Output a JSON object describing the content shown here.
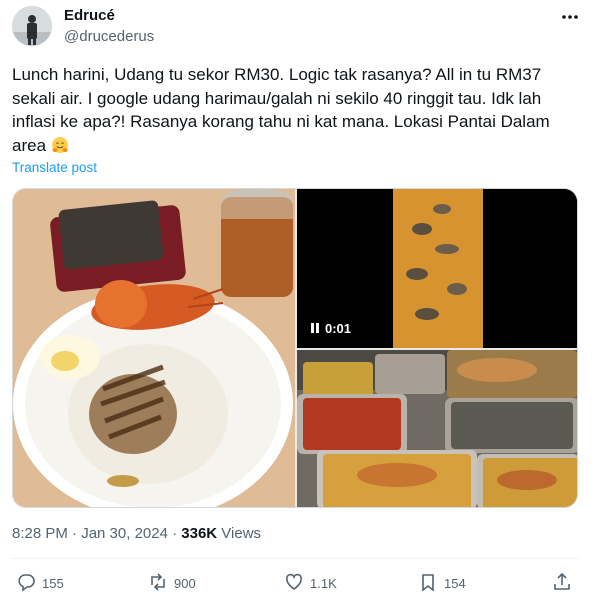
{
  "author": {
    "name": "Edrucé",
    "handle": "@drucederus"
  },
  "tweet": {
    "text": "Lunch harini, Udang tu sekor RM30. Logic tak rasanya? All in tu RM37 sekali air. I google udang harimau/galah ni sekilo 40 ringgit tau. Idk lah inflasi ke apa?! Rasanya korang tahu ni kat mana. Lokasi Pantai Dalam area",
    "emoji": "hugging-face",
    "translate_label": "Translate post",
    "time": "8:28 PM · Jan 30, 2024 · ",
    "views_count": "336K",
    "views_label": " Views"
  },
  "media": {
    "video_time": "0:01"
  },
  "actions": {
    "replies": "155",
    "reposts": "900",
    "likes": "1.1K",
    "bookmarks": "154"
  },
  "colors": {
    "accent": "#1d9bf0",
    "secondary_text": "#536471",
    "primary_text": "#0f1419"
  },
  "icons": [
    "more-icon",
    "reply-icon",
    "repost-icon",
    "like-icon",
    "bookmark-icon",
    "share-icon",
    "pause-icon"
  ]
}
